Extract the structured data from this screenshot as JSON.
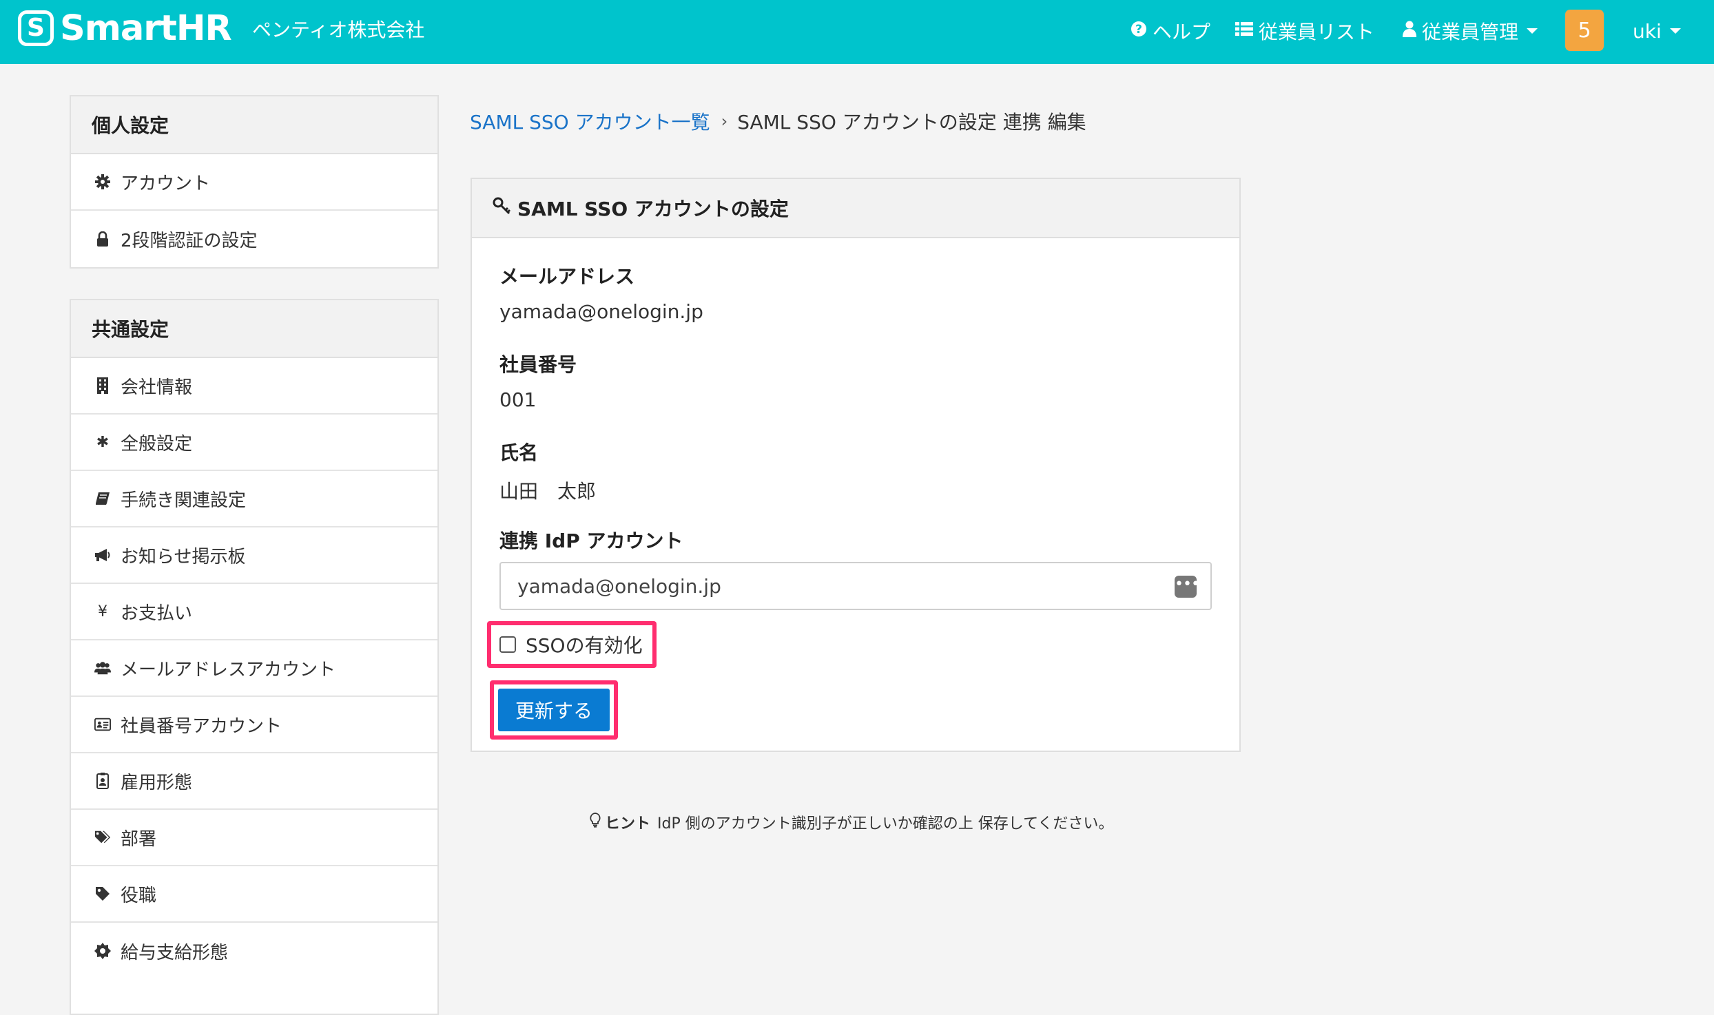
{
  "header": {
    "logo_mark": "S",
    "logo_text": "SmartHR",
    "company": "ペンティオ株式会社",
    "help": "ヘルプ",
    "employee_list": "従業員リスト",
    "employee_admin": "従業員管理",
    "notification_count": "5",
    "user": "uki",
    "accent_color": "#00c4cc"
  },
  "sidebar": {
    "personal": {
      "title": "個人設定",
      "items": [
        {
          "label": "アカウント",
          "icon": "gear-icon"
        },
        {
          "label": "2段階認証の設定",
          "icon": "lock-icon"
        }
      ]
    },
    "common": {
      "title": "共通設定",
      "items": [
        {
          "label": "会社情報",
          "icon": "building-icon"
        },
        {
          "label": "全般設定",
          "icon": "asterisk-icon"
        },
        {
          "label": "手続き関連設定",
          "icon": "book-icon"
        },
        {
          "label": "お知らせ掲示板",
          "icon": "megaphone-icon"
        },
        {
          "label": "お支払い",
          "icon": "yen-icon"
        },
        {
          "label": "メールアドレスアカウント",
          "icon": "users-icon"
        },
        {
          "label": "社員番号アカウント",
          "icon": "id-card-icon"
        },
        {
          "label": "雇用形態",
          "icon": "badge-icon"
        },
        {
          "label": "部署",
          "icon": "tags-icon"
        },
        {
          "label": "役職",
          "icon": "tag-icon"
        },
        {
          "label": "給与支給形態",
          "icon": "certificate-icon"
        }
      ]
    }
  },
  "breadcrumb": {
    "link": "SAML SSO アカウント一覧",
    "separator": "›",
    "current": "SAML SSO アカウントの設定 連携 編集"
  },
  "card": {
    "title": "SAML SSO アカウントの設定",
    "email_label": "メールアドレス",
    "email_value": "yamada@onelogin.jp",
    "employee_no_label": "社員番号",
    "employee_no_value": "001",
    "name_label": "氏名",
    "name_value": "山田　太郎",
    "idp_label": "連携 IdP アカウント",
    "idp_value": "yamada@onelogin.jp",
    "sso_label": "SSOの有効化",
    "sso_checked": false,
    "submit_label": "更新する",
    "highlight_color": "#ff2d6f",
    "button_color": "#0a7bd2"
  },
  "hint": {
    "title": "ヒント",
    "text": "IdP 側のアカウント識別子が正しいか確認の上 保存してください。"
  }
}
